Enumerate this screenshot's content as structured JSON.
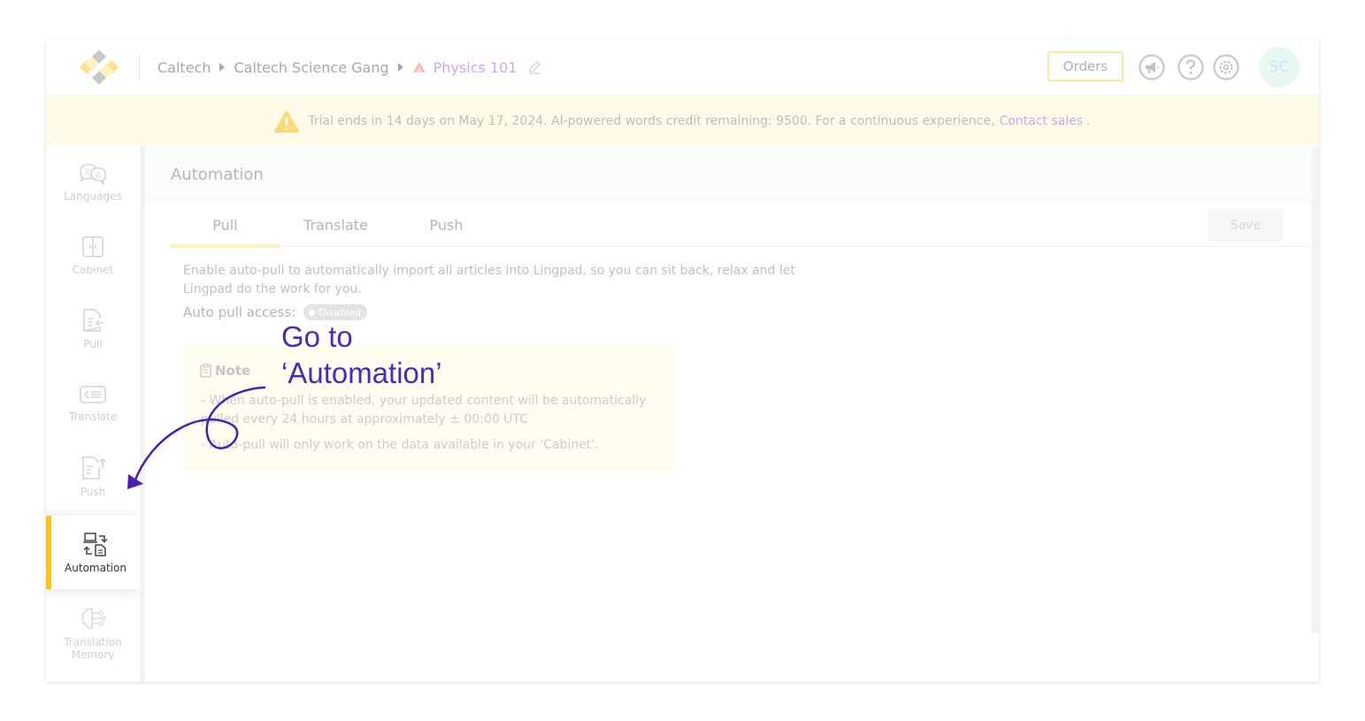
{
  "header": {
    "breadcrumb": [
      "Caltech",
      "Caltech Science Gang",
      "Physics 101"
    ],
    "orders_label": "Orders",
    "avatar_initials": "SC"
  },
  "banner": {
    "text": "Trial ends in 14 days on May 17, 2024. AI-powered words credit remaining: 9500. For a continuous experience,",
    "link": "Contact sales",
    "tail": "."
  },
  "sidebar": {
    "items": [
      {
        "label": "Languages",
        "icon": "languages-icon"
      },
      {
        "label": "Cabinet",
        "icon": "cabinet-icon"
      },
      {
        "label": "Pull",
        "icon": "pull-icon"
      },
      {
        "label": "Translate",
        "icon": "translate-icon"
      },
      {
        "label": "Push",
        "icon": "push-icon"
      },
      {
        "label": "Automation",
        "icon": "automation-icon",
        "active": true
      },
      {
        "label": "Translation Memory",
        "icon": "translation-memory-icon"
      }
    ]
  },
  "main": {
    "title": "Automation",
    "tabs": [
      {
        "label": "Pull",
        "active": true
      },
      {
        "label": "Translate"
      },
      {
        "label": "Push"
      }
    ],
    "save_label": "Save",
    "description": "Enable auto-pull to automatically import all articles into Lingpad, so you can sit back, relax and let Lingpad do the work for you.",
    "auto_pull_label": "Auto pull access:",
    "auto_pull_status": "Disabled",
    "note": {
      "title": "Note",
      "lines": [
        "- When auto-pull is enabled, your updated content will be automatically pulled every 24 hours at approximately ± 00:00 UTC",
        "- Auto-pull will only work on the data available in your 'Cabinet'."
      ]
    }
  },
  "annotation": {
    "line1": "Go to",
    "line2": "‘Automation’"
  },
  "colors": {
    "accent_yellow": "#f5c518",
    "link_purple": "#c9a9ec",
    "annotation": "#4a2bbd",
    "banner_bg": "#fffbe8"
  }
}
